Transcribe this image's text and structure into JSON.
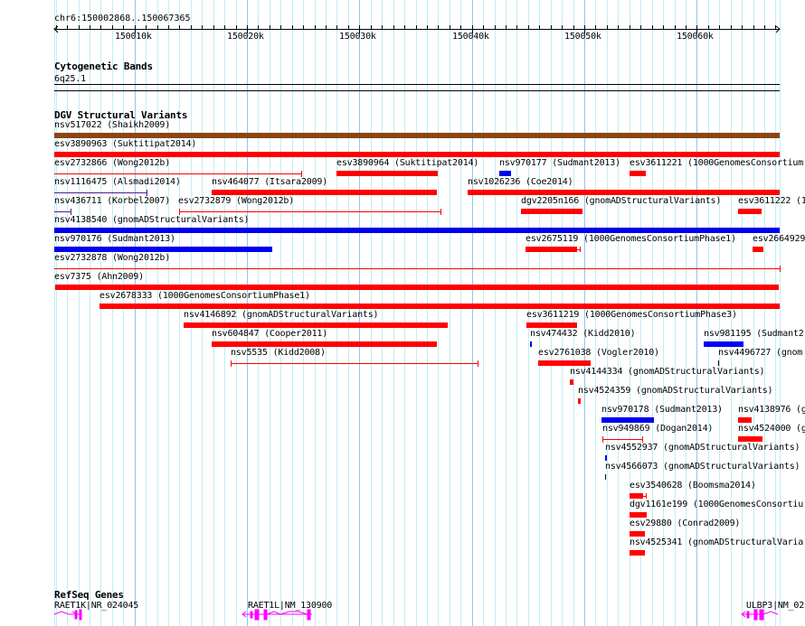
{
  "ruler": {
    "position": "chr6:150002868..150067365",
    "tick_labels": [
      "150010k",
      "150020k",
      "150030k",
      "150040k",
      "150050k",
      "150060k"
    ]
  },
  "cytobands": {
    "title": "Cytogenetic Bands",
    "band": "6q25.1"
  },
  "dgv": {
    "title": "DGV Structural Variants",
    "colors": {
      "brown": "#8B4513",
      "red": "#FF0000",
      "blue": "#0000EE",
      "purple": "#551A8B",
      "black": "#000000"
    },
    "features": [
      {
        "label": "nsv517022 (Shaikh2009)",
        "color": "#8B4513",
        "kind": "bar"
      },
      {
        "label": "esv3890963 (Suktitipat2014)",
        "color": "#FF0000",
        "kind": "bar"
      },
      {
        "label": "esv2732866 (Wong2012b)",
        "color": "#FF0000",
        "kind": "line"
      },
      {
        "label": "esv3890964 (Suktitipat2014)",
        "color": "#FF0000",
        "kind": "bar"
      },
      {
        "label": "nsv970177 (Sudmant2013)",
        "color": "#0000EE",
        "kind": "bar"
      },
      {
        "label": "esv3611221 (1000GenomesConsortium",
        "color": "#FF0000",
        "kind": "bar"
      },
      {
        "label": "nsv1116475 (Alsmadi2014)",
        "color": "#551A8B",
        "kind": "line"
      },
      {
        "label": "nsv464077 (Itsara2009)",
        "color": "#FF0000",
        "kind": "bar"
      },
      {
        "label": "nsv1026236 (Coe2014)",
        "color": "#FF0000",
        "kind": "bar"
      },
      {
        "label": "nsv436711 (Korbel2007)",
        "color": "#551A8B",
        "kind": "line"
      },
      {
        "label": "esv2732879 (Wong2012b)",
        "color": "#FF0000",
        "kind": "line"
      },
      {
        "label": "dgv2205n166 (gnomADStructuralVariants)",
        "color": "#FF0000",
        "kind": "bar"
      },
      {
        "label": "esv3611222 (1",
        "color": "#FF0000",
        "kind": "bar"
      },
      {
        "label": "nsv4138540 (gnomADStructuralVariants)",
        "color": "#0000EE",
        "kind": "bar"
      },
      {
        "label": "nsv970176 (Sudmant2013)",
        "color": "#0000EE",
        "kind": "bar"
      },
      {
        "label": "esv2675119 (1000GenomesConsortiumPhase1)",
        "color": "#FF0000",
        "kind": "bar"
      },
      {
        "label": "esv2664929",
        "color": "#FF0000",
        "kind": "bar"
      },
      {
        "label": "esv2732878 (Wong2012b)",
        "color": "#FF0000",
        "kind": "line"
      },
      {
        "label": "esv7375 (Ahn2009)",
        "color": "#FF0000",
        "kind": "bar"
      },
      {
        "label": "esv2678333 (1000GenomesConsortiumPhase1)",
        "color": "#FF0000",
        "kind": "bar"
      },
      {
        "label": "nsv4146892 (gnomADStructuralVariants)",
        "color": "#FF0000",
        "kind": "bar"
      },
      {
        "label": "esv3611219 (1000GenomesConsortiumPhase3)",
        "color": "#FF0000",
        "kind": "bar"
      },
      {
        "label": "nsv604847 (Cooper2011)",
        "color": "#FF0000",
        "kind": "bar"
      },
      {
        "label": "nsv474432 (Kidd2010)",
        "color": "#0000EE",
        "kind": "bar"
      },
      {
        "label": "nsv981195 (Sudmant2",
        "color": "#0000EE",
        "kind": "bar"
      },
      {
        "label": "nsv5535 (Kidd2008)",
        "color": "#FF0000",
        "kind": "line"
      },
      {
        "label": "esv2761038 (Vogler2010)",
        "color": "#FF0000",
        "kind": "bar"
      },
      {
        "label": "nsv4496727 (gnom",
        "color": "#000000",
        "kind": "bar"
      },
      {
        "label": "nsv4144334 (gnomADStructuralVariants)",
        "color": "#FF0000",
        "kind": "bar"
      },
      {
        "label": "nsv4524359 (gnomADStructuralVariants)",
        "color": "#FF0000",
        "kind": "bar"
      },
      {
        "label": "nsv970178 (Sudmant2013)",
        "color": "#0000EE",
        "kind": "bar"
      },
      {
        "label": "nsv4138976 (g",
        "color": "#FF0000",
        "kind": "bar"
      },
      {
        "label": "nsv949869 (Dogan2014)",
        "color": "#FF0000",
        "kind": "line"
      },
      {
        "label": "nsv4524000 (g",
        "color": "#FF0000",
        "kind": "bar"
      },
      {
        "label": "nsv4552937 (gnomADStructuralVariants)",
        "color": "#0000EE",
        "kind": "bar"
      },
      {
        "label": "nsv4566073 (gnomADStructuralVariants)",
        "color": "#000000",
        "kind": "bar"
      },
      {
        "label": "esv3540628 (Boomsma2014)",
        "color": "#FF0000",
        "kind": "bar"
      },
      {
        "label": "dgv1161e199 (1000GenomesConsortiu",
        "color": "#FF0000",
        "kind": "bar"
      },
      {
        "label": "esv29880 (Conrad2009)",
        "color": "#FF0000",
        "kind": "bar"
      },
      {
        "label": "nsv4525341 (gnomADStructuralVaria",
        "color": "#FF0000",
        "kind": "bar"
      }
    ]
  },
  "refseq": {
    "title": "RefSeq Genes",
    "color": "#FF00FF",
    "genes": [
      {
        "label": "RAET1K|NR_024045"
      },
      {
        "label": "RAET1L|NM_130900"
      },
      {
        "label": "ULBP3|NM_02"
      }
    ]
  }
}
